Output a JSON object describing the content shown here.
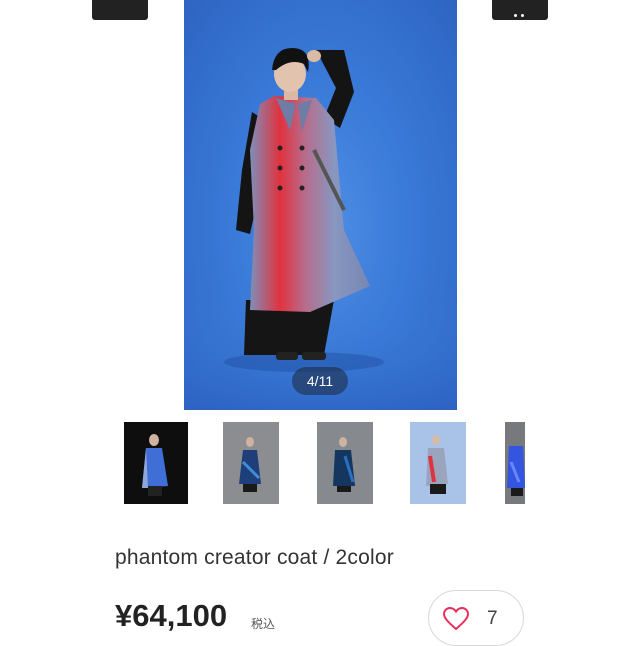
{
  "gallery": {
    "counter": "4/11",
    "thumbnails": [
      {
        "name": "thumb-1",
        "background": "#0e0e0e",
        "coat": "#3f6fd6"
      },
      {
        "name": "thumb-2",
        "background": "#8b8d90",
        "coat": "#1e3f7a"
      },
      {
        "name": "thumb-3",
        "background": "#868a8e",
        "coat": "#15365f"
      },
      {
        "name": "thumb-4",
        "background": "#a9c3e8",
        "coat": "#9aa4bd"
      },
      {
        "name": "thumb-5",
        "background": "#77797c",
        "coat": "#3355e0"
      }
    ]
  },
  "product": {
    "title": "phantom creator coat / 2color",
    "price": "¥64,100",
    "tax_label": "税込"
  },
  "like": {
    "count": "7",
    "icon": "heart-outline-icon",
    "color": "#e8305a"
  },
  "colors": {
    "photo_background": "#3a7ad8",
    "text": "#333333"
  }
}
